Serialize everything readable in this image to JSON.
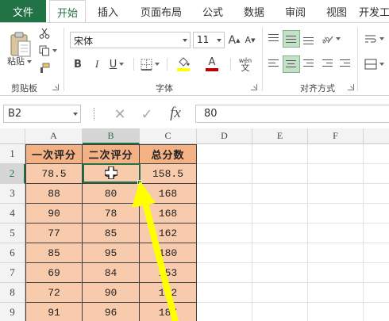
{
  "ribbon_tabs": [
    "文件",
    "开始",
    "插入",
    "页面布局",
    "公式",
    "数据",
    "审阅",
    "视图",
    "开发工"
  ],
  "active_tab": "开始",
  "clipboard": {
    "paste_label": "粘贴",
    "group_label": "剪贴板"
  },
  "font": {
    "name": "宋体",
    "size": "11",
    "group_label": "字体",
    "bold": "B",
    "italic": "I",
    "underline": "U",
    "grow": "A",
    "shrink": "A",
    "font_color_glyph": "A",
    "phonetic": "wén"
  },
  "alignment": {
    "group_label": "对齐方式"
  },
  "formula_bar": {
    "name_box": "B2",
    "cancel": "✕",
    "enter": "✓",
    "fx": "fx",
    "value": "80"
  },
  "sheet": {
    "columns": [
      "A",
      "B",
      "C",
      "D",
      "E",
      "F"
    ],
    "selected_column": "B",
    "rows": [
      "1",
      "2",
      "3",
      "4",
      "5",
      "6",
      "7",
      "8",
      "9"
    ],
    "selected_row": "2",
    "headers": [
      "一次评分",
      "二次评分",
      "总分数"
    ],
    "data": [
      [
        "78.5",
        "80",
        "158.5"
      ],
      [
        "88",
        "80",
        "168"
      ],
      [
        "90",
        "78",
        "168"
      ],
      [
        "77",
        "85",
        "162"
      ],
      [
        "85",
        "95",
        "180"
      ],
      [
        "69",
        "84",
        "153"
      ],
      [
        "72",
        "90",
        "162"
      ],
      [
        "91",
        "96",
        "187"
      ]
    ],
    "active_cell": "B2"
  },
  "colors": {
    "accent": "#217346",
    "header_fill": "#f4b183",
    "data_fill": "#f8cbad",
    "arrow": "#ffff00"
  },
  "annotation": {
    "arrow_icon": "yellow-arrow-icon",
    "cursor_icon": "plus-cross-cursor-icon"
  }
}
